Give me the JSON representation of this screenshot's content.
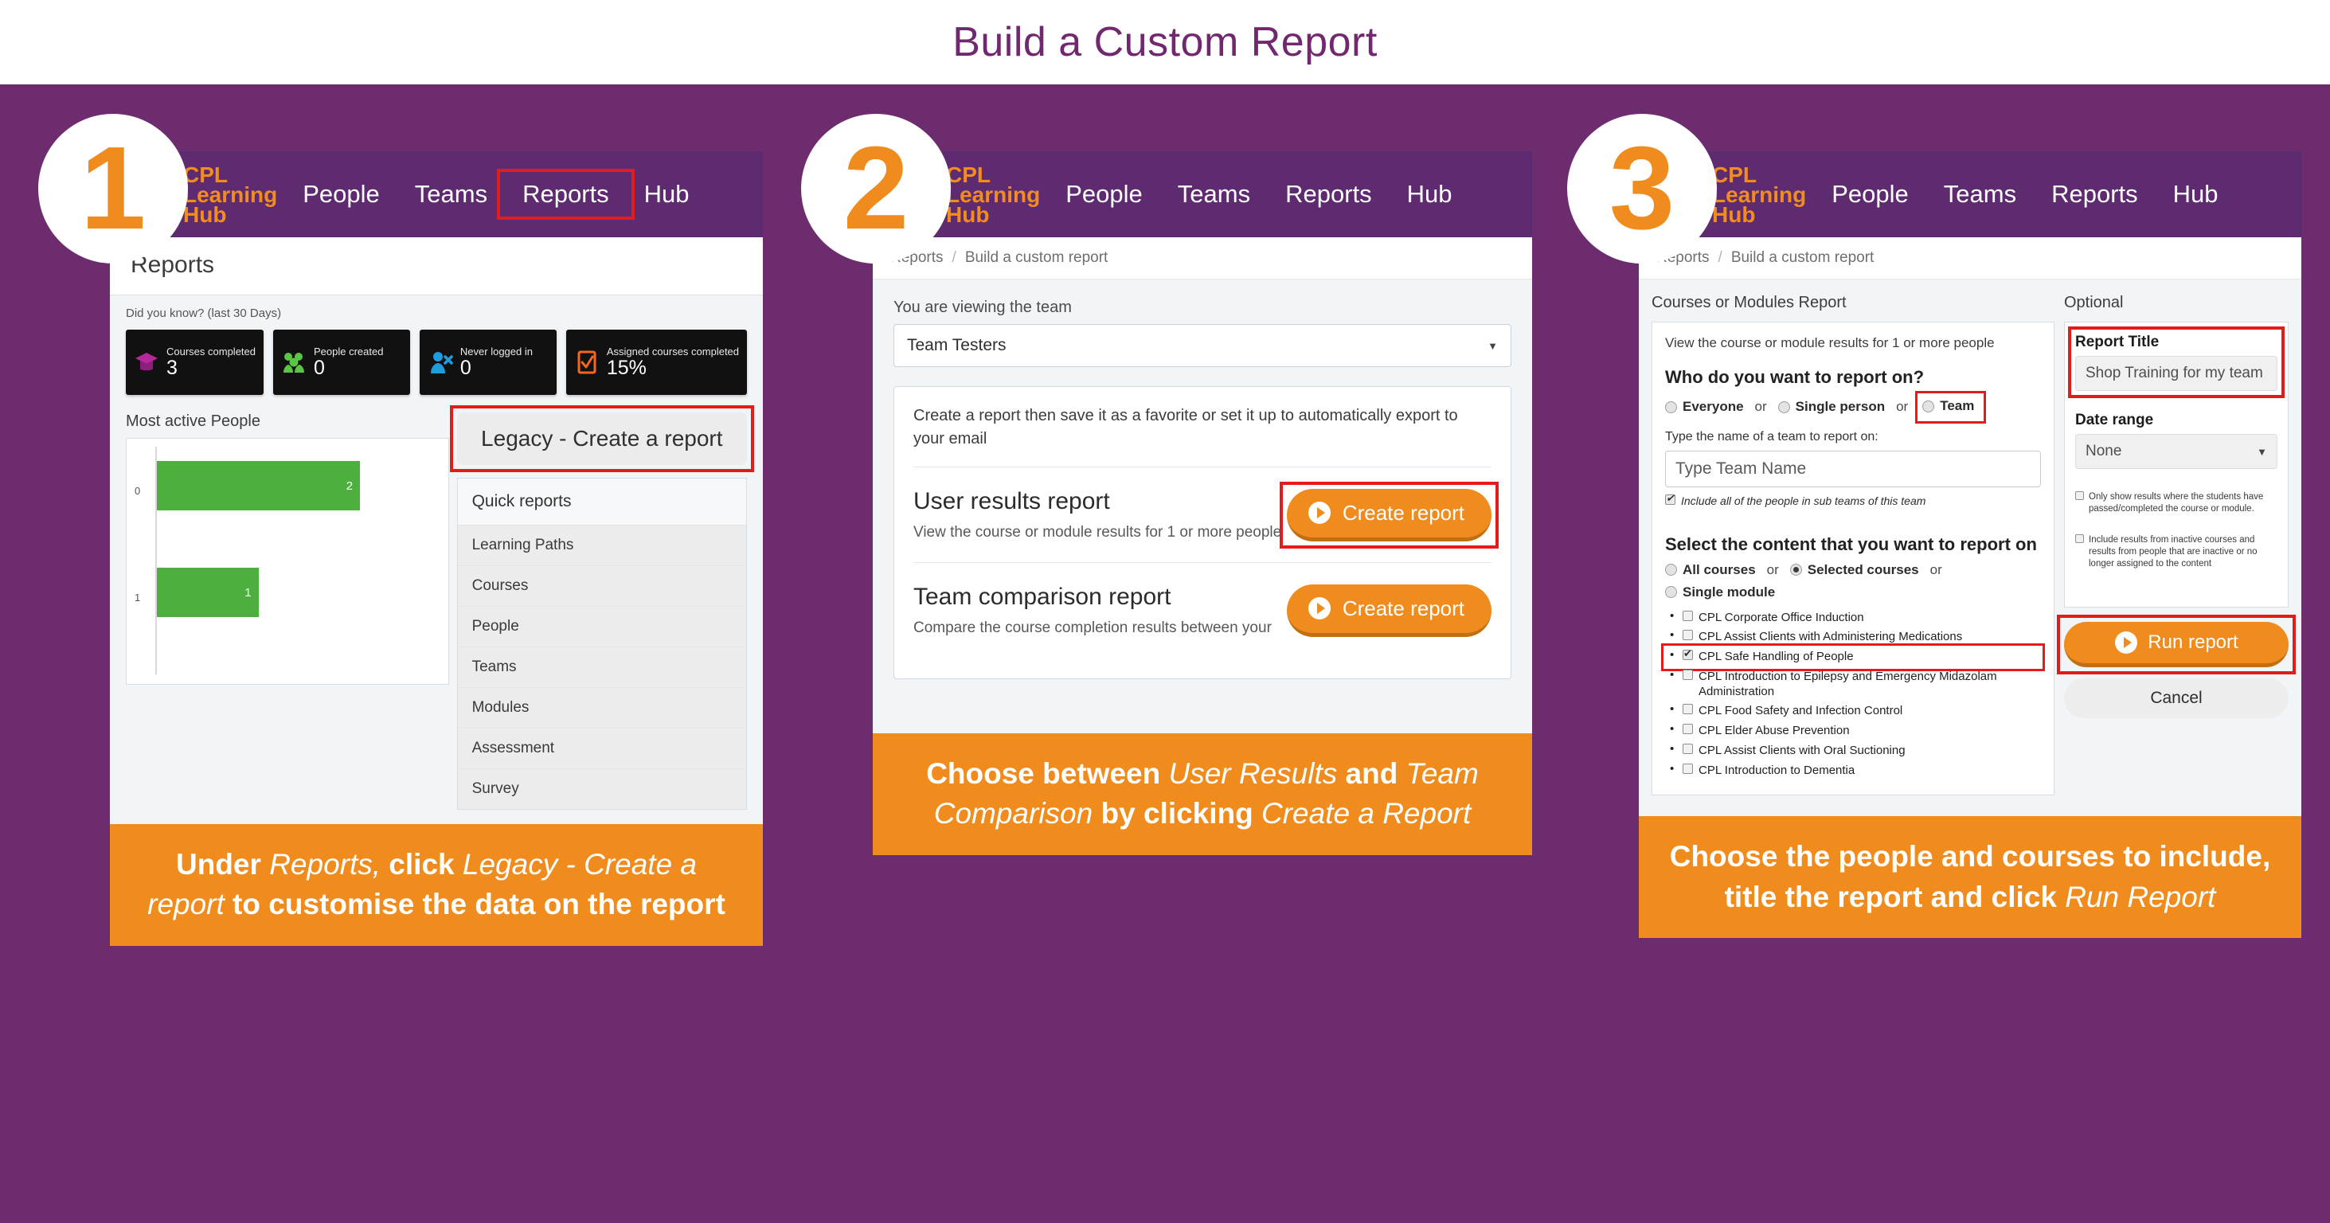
{
  "page": {
    "title": "Build a Custom Report"
  },
  "colors": {
    "purple_bg": "#6C2C6E",
    "nav_purple": "#5E2A70",
    "orange": "#F08C1E",
    "highlight_red": "#E21B1B",
    "title_purple": "#72286F",
    "bar_green": "#4CAF3E"
  },
  "brand": {
    "line1": "CPL",
    "line2": "Learning",
    "line3": "Hub",
    "icon": "lightbulb-icon"
  },
  "nav": {
    "items": [
      "People",
      "Teams",
      "Reports",
      "Hub"
    ]
  },
  "steps": [
    {
      "number": "1"
    },
    {
      "number": "2"
    },
    {
      "number": "3"
    }
  ],
  "panel1": {
    "page_title": "Reports",
    "did_you_know": "Did you know? (last 30 Days)",
    "stats": [
      {
        "label": "Courses completed",
        "value": "3",
        "icon": "graduation-cap-icon",
        "color": "#B5279B"
      },
      {
        "label": "People created",
        "value": "0",
        "icon": "people-group-icon",
        "color": "#5CC446"
      },
      {
        "label": "Never logged in",
        "value": "0",
        "icon": "person-x-icon",
        "color": "#1E9CE0"
      },
      {
        "label": "Assigned courses completed",
        "value": "15%",
        "icon": "checklist-icon",
        "color": "#F4681F"
      }
    ],
    "chart_heading": "Most active People",
    "legacy_button": "Legacy - Create a report",
    "quick_reports_title": "Quick reports",
    "quick_reports": [
      "Learning Paths",
      "Courses",
      "People",
      "Teams",
      "Modules",
      "Assessment",
      "Survey"
    ],
    "caption": {
      "parts": [
        {
          "text": "Under ",
          "style": "bold"
        },
        {
          "text": "Reports,",
          "style": "italic"
        },
        {
          "text": " click ",
          "style": "bold"
        },
        {
          "text": "Legacy - Create a report",
          "style": "italic"
        },
        {
          "text": " to customise the data on the report",
          "style": "bold"
        }
      ]
    }
  },
  "panel2": {
    "breadcrumb": [
      "Reports",
      "Build a custom report"
    ],
    "team_label": "You are viewing the team",
    "team_value": "Team Testers",
    "card_intro": "Create a report then save it as a favorite or set it up to automatically export to your email",
    "reports": [
      {
        "name": "User results report",
        "desc": "View the course or module results for 1 or more people",
        "button": "Create report",
        "highlighted": true
      },
      {
        "name": "Team comparison report",
        "desc": "Compare the course completion results between your",
        "button": "Create report",
        "highlighted": false
      }
    ],
    "caption": {
      "parts": [
        {
          "text": "Choose between ",
          "style": "bold"
        },
        {
          "text": "User Results",
          "style": "italic"
        },
        {
          "text": " and ",
          "style": "bold"
        },
        {
          "text": "Team Comparison",
          "style": "italic"
        },
        {
          "text": " by clicking ",
          "style": "bold"
        },
        {
          "text": "Create a Report",
          "style": "italic"
        }
      ]
    }
  },
  "panel3": {
    "breadcrumb": [
      "Reports",
      "Build a custom report"
    ],
    "left_col_heading": "Courses or Modules Report",
    "right_col_heading": "Optional",
    "intro": "View the course or module results for 1 or more people",
    "who_question": "Who do you want to report on?",
    "who_options": [
      {
        "label": "Everyone",
        "selected": false
      },
      {
        "label": "Single person",
        "selected": false
      },
      {
        "label": "Team",
        "selected": false,
        "highlighted": true
      }
    ],
    "or_text": "or",
    "team_prompt": "Type the name of a team to report on:",
    "team_placeholder": "Type Team Name",
    "include_subteams": "Include all of the people in sub teams of this team",
    "include_subteams_checked": true,
    "content_question": "Select the content that you want to report on",
    "content_options": [
      {
        "label": "All courses",
        "selected": false
      },
      {
        "label": "Selected courses",
        "selected": true
      },
      {
        "label": "Single module",
        "selected": false
      }
    ],
    "courses": [
      {
        "label": "CPL Corporate Office Induction",
        "checked": false,
        "highlighted": false
      },
      {
        "label": "CPL Assist Clients with Administering Medications",
        "checked": false,
        "highlighted": false
      },
      {
        "label": "CPL Safe Handling of People",
        "checked": true,
        "highlighted": true
      },
      {
        "label": "CPL Introduction to Epilepsy and Emergency Midazolam Administration",
        "checked": false,
        "highlighted": false
      },
      {
        "label": "CPL Food Safety and Infection Control",
        "checked": false,
        "highlighted": false
      },
      {
        "label": "CPL Elder Abuse Prevention",
        "checked": false,
        "highlighted": false
      },
      {
        "label": "CPL Assist Clients with Oral Suctioning",
        "checked": false,
        "highlighted": false
      },
      {
        "label": "CPL Introduction to Dementia",
        "checked": false,
        "highlighted": false
      }
    ],
    "report_title_label": "Report Title",
    "report_title_value": "Shop Training for my team",
    "date_range_label": "Date range",
    "date_range_value": "None",
    "opt_check_1": "Only show results where the students have passed/completed the course or module.",
    "opt_check_2": "Include results from inactive courses and results from people that are inactive or no longer assigned to the content",
    "run_button": "Run report",
    "cancel_button": "Cancel",
    "caption": {
      "parts": [
        {
          "text": "Choose the people and courses to include, title the report and click ",
          "style": "bold"
        },
        {
          "text": "Run Report",
          "style": "italic"
        }
      ]
    }
  },
  "chart_data": {
    "type": "bar",
    "title": "Most active People",
    "orientation": "horizontal",
    "categories": [
      "0",
      "1"
    ],
    "values": [
      2,
      1
    ],
    "xlabel": "",
    "ylabel": "",
    "xlim": [
      0,
      2.5
    ],
    "grid": false,
    "series_color": "#4CAF3E",
    "data_labels": [
      "2",
      "1"
    ]
  }
}
